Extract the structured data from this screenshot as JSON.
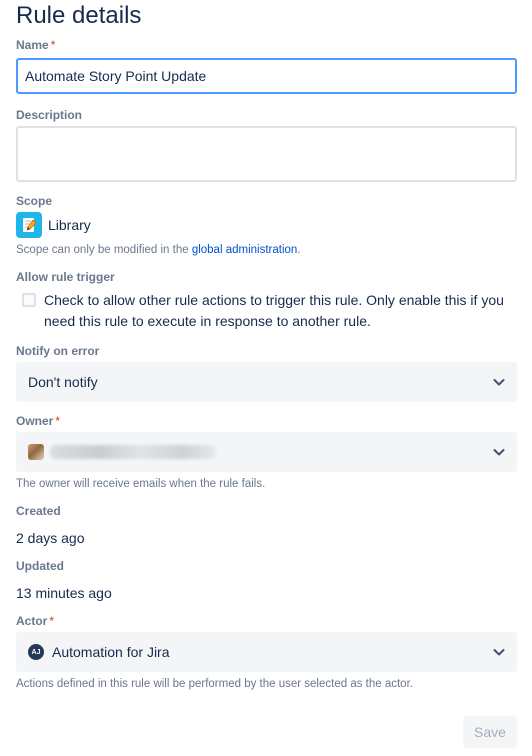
{
  "page": {
    "title": "Rule details"
  },
  "name": {
    "label": "Name",
    "required_mark": "*",
    "value": "Automate Story Point Update"
  },
  "description": {
    "label": "Description",
    "value": ""
  },
  "scope": {
    "label": "Scope",
    "value": "Library",
    "icon": "notebook-pencil-icon",
    "help_prefix": "Scope can only be modified in the ",
    "help_link": "global administration",
    "help_suffix": "."
  },
  "rule_trigger": {
    "label": "Allow rule trigger",
    "checked": false,
    "text": "Check to allow other rule actions to trigger this rule. Only enable this if you need this rule to execute in response to another rule."
  },
  "notify": {
    "label": "Notify on error",
    "value": "Don't notify"
  },
  "owner": {
    "label": "Owner",
    "required_mark": "*",
    "help": "The owner will receive emails when the rule fails."
  },
  "created": {
    "label": "Created",
    "value": "2 days ago"
  },
  "updated": {
    "label": "Updated",
    "value": "13 minutes ago"
  },
  "actor": {
    "label": "Actor",
    "required_mark": "*",
    "initials": "AJ",
    "value": "Automation for Jira",
    "help": "Actions defined in this rule will be performed by the user selected as the actor."
  },
  "actions": {
    "save_label": "Save"
  },
  "colors": {
    "accent_focus": "#4C9AFF",
    "link": "#0052CC",
    "required": "#DE350B",
    "scope_icon_bg": "#1FB6E8"
  }
}
